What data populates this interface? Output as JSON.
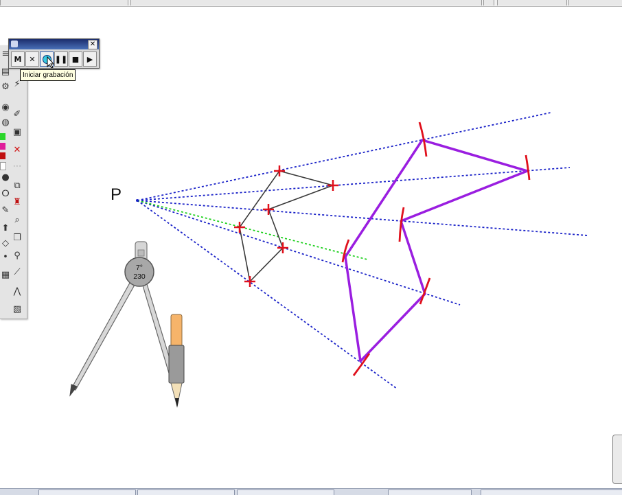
{
  "recorder": {
    "buttons": [
      {
        "name": "minimize-button",
        "label": "M"
      },
      {
        "name": "close-recording-button",
        "label": "✕"
      },
      {
        "name": "record-button",
        "label": ""
      },
      {
        "name": "pause-button",
        "label": "❚❚"
      },
      {
        "name": "stop-button",
        "label": "■"
      },
      {
        "name": "play-button",
        "label": "▶"
      }
    ],
    "close_label": "✕",
    "tooltip": "Iniciar grabación"
  },
  "canvas": {
    "point_label": "P",
    "compass_readout_angle": "7°",
    "compass_readout_value": "230"
  },
  "colors": {
    "ray": "#1a22c8",
    "guide": "#1ed01e",
    "marker": "#e0101c",
    "polygon_original": "#3a3a3a",
    "polygon_scaled": "#9a1ee0"
  },
  "toolbar_swatches": [
    "#2ad62a",
    "#e01c9a",
    "#c01010",
    "#ffffff",
    "#111111"
  ]
}
